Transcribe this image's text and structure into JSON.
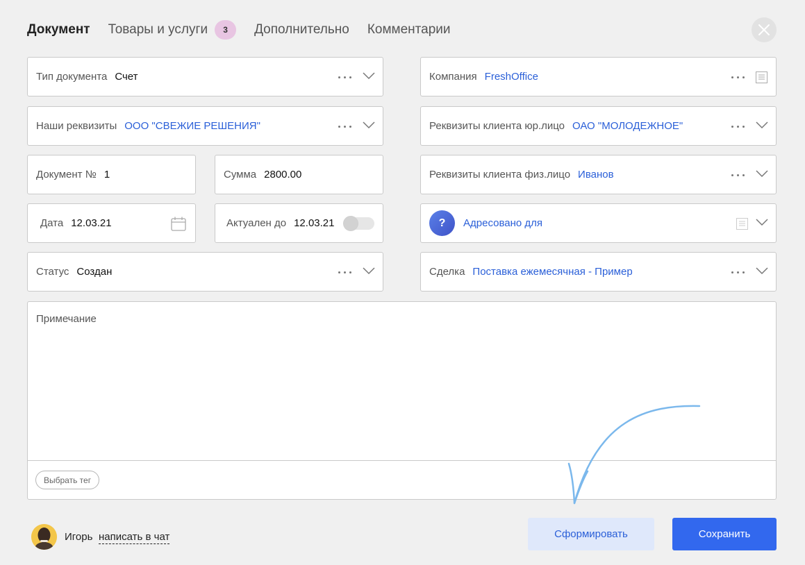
{
  "tabs": [
    {
      "label": "Документ",
      "active": true
    },
    {
      "label": "Товары и услуги",
      "badge": "3"
    },
    {
      "label": "Дополнительно"
    },
    {
      "label": "Комментарии"
    }
  ],
  "left_fields": {
    "doc_type": {
      "label": "Тип документа",
      "value": "Счет"
    },
    "our_details": {
      "label": "Наши реквизиты",
      "value": "ООО \"СВЕЖИЕ РЕШЕНИЯ\""
    },
    "doc_number": {
      "label": "Документ №",
      "value": "1"
    },
    "sum": {
      "label": "Сумма",
      "value": "2800.00"
    },
    "date": {
      "label": "Дата",
      "value": "12.03.21"
    },
    "valid_until": {
      "label": "Актуален до",
      "value": "12.03.21",
      "toggle_on": false
    },
    "status": {
      "label": "Статус",
      "value": "Создан"
    }
  },
  "right_fields": {
    "company": {
      "label": "Компания",
      "value": "FreshOffice"
    },
    "client_legal": {
      "label": "Реквизиты клиента юр.лицо",
      "value": "ОАО \"МОЛОДЕЖНОЕ\""
    },
    "client_person": {
      "label": "Реквизиты клиента физ.лицо",
      "value": "Иванов"
    },
    "addressed": {
      "value": "Адресовано для",
      "icon": "?"
    },
    "deal": {
      "label": "Сделка",
      "value": "Поставка ежемесячная - Пример"
    }
  },
  "note": {
    "label": "Примечание",
    "tag_button": "Выбрать тег"
  },
  "footer": {
    "user_name": "Игорь",
    "chat_link": "написать в чат",
    "generate_button": "Сформировать",
    "save_button": "Сохранить"
  },
  "colors": {
    "accent": "#3268ee",
    "link": "#2a5fd8",
    "badge_bg": "#e8c5e2",
    "generate_bg": "#dfe8fb",
    "annotation_arrow": "#7bb8ec"
  }
}
